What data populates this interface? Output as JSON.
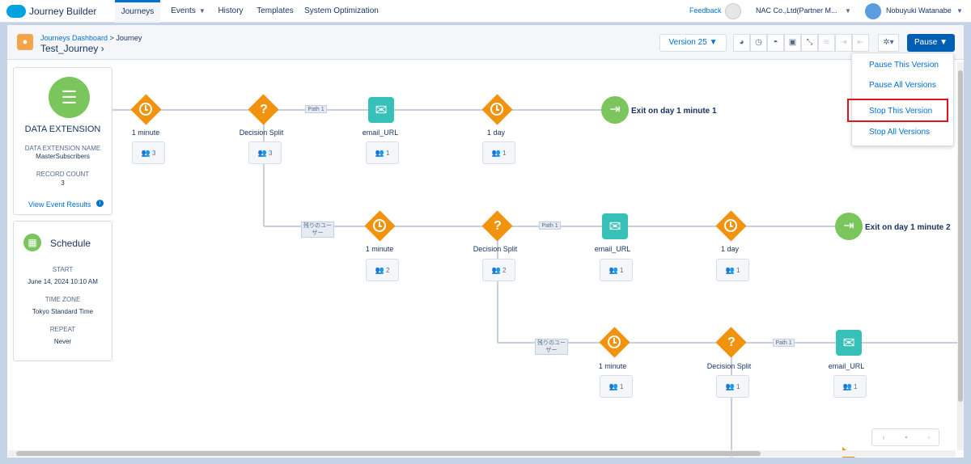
{
  "app": {
    "name": "Journey Builder"
  },
  "nav": {
    "tabs": [
      {
        "label": "Journeys",
        "active": true
      },
      {
        "label": "Events",
        "dropdown": true
      },
      {
        "label": "History"
      },
      {
        "label": "Templates"
      },
      {
        "label": "System Optimization"
      }
    ]
  },
  "topbar": {
    "feedback": "Feedback",
    "org": "NAC Co.,Ltd(Partner M...",
    "user": "Nobuyuki Watanabe"
  },
  "header": {
    "breadcrumb_link": "Journeys Dashboard",
    "breadcrumb_sep": ">",
    "breadcrumb_current": "Journey",
    "title": "Test_Journey",
    "version": "Version 25",
    "pause": "Pause"
  },
  "menu": {
    "items": [
      "Pause This Version",
      "Pause All Versions",
      "Stop This Version",
      "Stop All Versions"
    ],
    "highlighted": "Stop This Version"
  },
  "entry": {
    "title": "DATA EXTENSION",
    "name_label": "DATA EXTENSION NAME",
    "name_value": "MasterSubscribers",
    "count_label": "RECORD COUNT",
    "count_value": "3",
    "link": "View Event Results"
  },
  "schedule": {
    "title": "Schedule",
    "start_label": "START",
    "start_value": "June 14, 2024 10:10 AM",
    "tz_label": "TIME ZONE",
    "tz_value": "Tokyo Standard Time",
    "repeat_label": "REPEAT",
    "repeat_value": "Never"
  },
  "canvas": {
    "row1": {
      "wait1": "1 minute",
      "wait1_count": "3",
      "split": "Decision Split",
      "split_count": "3",
      "path": "Path 1",
      "email": "email_URL",
      "email_count": "1",
      "wait2": "1 day",
      "wait2_count": "1",
      "exit": "Exit on day 1 minute 1"
    },
    "remaining": "残りのユーザー",
    "row2": {
      "wait1": "1 minute",
      "wait1_count": "2",
      "split": "Decision Split",
      "split_count": "2",
      "path": "Path 1",
      "email": "email_URL",
      "email_count": "1",
      "wait2": "1 day",
      "wait2_count": "1",
      "exit": "Exit on day 1 minute 2"
    },
    "row3": {
      "wait1": "1 minute",
      "wait1_count": "1",
      "split": "Decision Split",
      "split_count": "1",
      "path": "Path 1",
      "email": "email_URL",
      "email_count": "1"
    }
  },
  "colors": {
    "accent": "#0070d2",
    "wait": "#f2930f",
    "email": "#36c0b7",
    "exit": "#7ac55c",
    "highlight": "#e0161d"
  }
}
